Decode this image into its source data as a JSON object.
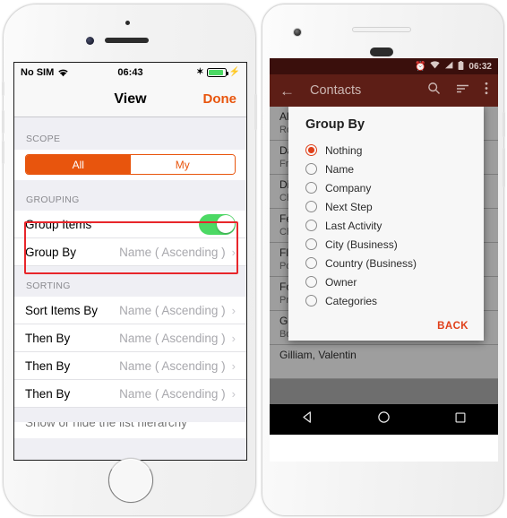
{
  "ios": {
    "status": {
      "carrier": "No SIM",
      "wifi_icon": "wifi-icon",
      "time": "06:43",
      "bluetooth_icon": "bluetooth-icon",
      "battery_icon": "battery-icon",
      "charging_icon": "charging-bolt-icon",
      "battery_color": "#4CD964"
    },
    "nav": {
      "title": "View",
      "done_label": "Done",
      "accent": "#E8550D"
    },
    "sections": [
      {
        "header": "SCOPE",
        "segmented": {
          "options": [
            "All",
            "My"
          ],
          "selected": "All"
        }
      },
      {
        "header": "GROUPING",
        "rows": [
          {
            "label": "Group Items",
            "control": "switch",
            "switch_on": true,
            "switch_color": "#4CD964"
          },
          {
            "label": "Group By",
            "value": "Name ( Ascending )",
            "chevron": "chevron-right-icon"
          }
        ],
        "highlight_color": "#e8262b"
      },
      {
        "header": "SORTING",
        "rows": [
          {
            "label": "Sort Items By",
            "value": "Name ( Ascending )",
            "chevron": "chevron-right-icon"
          },
          {
            "label": "Then By",
            "value": "Name ( Ascending )",
            "chevron": "chevron-right-icon"
          },
          {
            "label": "Then By",
            "value": "Name ( Ascending )",
            "chevron": "chevron-right-icon"
          },
          {
            "label": "Then By",
            "value": "Name ( Ascending )",
            "chevron": "chevron-right-icon"
          }
        ]
      }
    ],
    "cut_off_row": "Show or hide the list hierarchy"
  },
  "android": {
    "status": {
      "alarm_icon": "alarm-icon",
      "wifi_icon": "wifi-icon",
      "signal_icon": "signal-icon",
      "battery_icon": "battery-icon",
      "time": "06:32",
      "bar_color": "#3a0f0c"
    },
    "appbar": {
      "back_icon": "back-arrow-icon",
      "title": "Contacts",
      "search_icon": "search-icon",
      "sort_icon": "sort-icon",
      "overflow_icon": "overflow-menu-icon",
      "bar_color": "#5d1e16"
    },
    "contacts": [
      {
        "name": "Albertson, Kim",
        "company": "Rockwell Industries"
      },
      {
        "name": "Davis, Tom",
        "company": "Franklin Supply Co"
      },
      {
        "name": "Dixon, Mary",
        "company": "Chambers Group Ltd"
      },
      {
        "name": "Ferris, Ann",
        "company": "Chapman Brothers Inc"
      },
      {
        "name": "Fletcher, Sam",
        "company": "Porter Holdings"
      },
      {
        "name": "Foster, Lee",
        "company": "Preston Trading Co"
      },
      {
        "name": "Garan, Olivia Eng",
        "company": "Bolton & Bell Inc (Mc Minnville)"
      },
      {
        "name": "Gilliam, Valentin",
        "company": ""
      }
    ],
    "dialog": {
      "title": "Group By",
      "options": [
        {
          "label": "Nothing",
          "selected": true
        },
        {
          "label": "Name",
          "selected": false
        },
        {
          "label": "Company",
          "selected": false
        },
        {
          "label": "Next Step",
          "selected": false
        },
        {
          "label": "Last Activity",
          "selected": false
        },
        {
          "label": "City (Business)",
          "selected": false
        },
        {
          "label": "Country (Business)",
          "selected": false
        },
        {
          "label": "Owner",
          "selected": false
        },
        {
          "label": "Categories",
          "selected": false
        }
      ],
      "back_label": "BACK",
      "accent": "#E0401A"
    },
    "navbar": {
      "back_icon": "nav-back-triangle-icon",
      "home_icon": "nav-home-circle-icon",
      "recents_icon": "nav-recents-square-icon"
    }
  }
}
